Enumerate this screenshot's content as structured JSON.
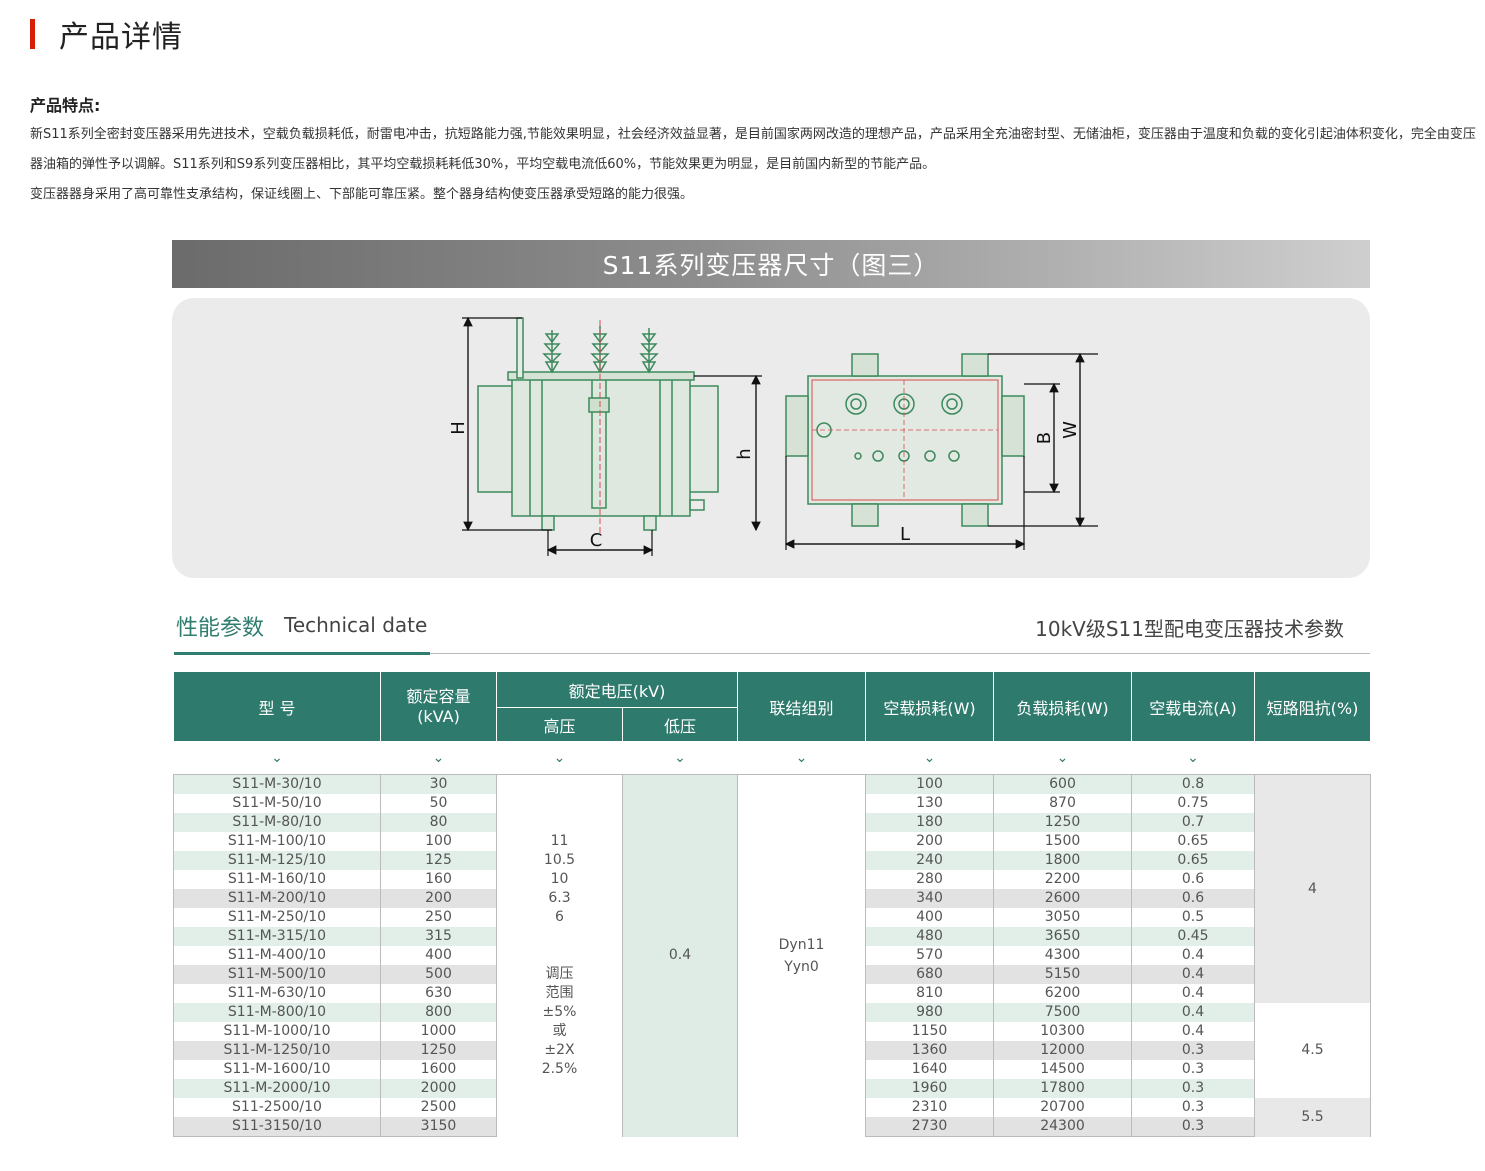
{
  "header": {
    "title": "产品详情"
  },
  "features": {
    "label": "产品特点:",
    "p1": "新S11系列全密封变压器采用先进技术，空载负载损耗低，耐雷电冲击，抗短路能力强,节能效果明显，社会经济效益显著，是目前国家两网改造的理想产品，产品采用全充油密封型、无储油柜，变压器由于温度和负载的变化引起油体积变化，完全由变压器油箱的弹性予以调解。S11系列和S9系列变压器相比，其平均空载损耗耗低30%，平均空载电流低60%，节能效果更为明显，是目前国内新型的节能产品。",
    "p2": "变压器器身采用了高可靠性支承结构，保证线圈上、下部能可靠压紧。整个器身结构使变压器承受短路的能力很强。"
  },
  "figure": {
    "banner": "S11系列变压器尺寸（图三）",
    "labels": {
      "H": "H",
      "h": "h",
      "C": "C",
      "L": "L",
      "B": "B",
      "W": "W"
    }
  },
  "perf": {
    "title_cn": "性能参数",
    "title_en": "Technical date",
    "right_title": "10kV级S11型配电变压器技术参数"
  },
  "table": {
    "headers": {
      "model": "型 号",
      "capacity": "额定容量\n(kVA)",
      "voltage": "额定电压(kV)",
      "hv": "高压",
      "lv": "低压",
      "group": "联结组别",
      "no_load_loss": "空载损耗(W)",
      "load_loss": "负载损耗(W)",
      "no_load_current": "空载电流(A)",
      "impedance": "短路阻抗(%)"
    },
    "arrow": "⌄",
    "hv_text": "11\n10.5\n10\n6.3\n6\n\n\n调压\n范围\n±5%\n或\n±2X\n2.5%",
    "lv_value": "0.4",
    "group_text": "Dyn11\nYyn0",
    "impedance_groups": [
      "4",
      "4.5",
      "5.5"
    ],
    "rows": [
      {
        "model": "S11-M-30/10",
        "cap": "30",
        "p0": "100",
        "pk": "600",
        "i0": "0.8"
      },
      {
        "model": "S11-M-50/10",
        "cap": "50",
        "p0": "130",
        "pk": "870",
        "i0": "0.75"
      },
      {
        "model": "S11-M-80/10",
        "cap": "80",
        "p0": "180",
        "pk": "1250",
        "i0": "0.7"
      },
      {
        "model": "S11-M-100/10",
        "cap": "100",
        "p0": "200",
        "pk": "1500",
        "i0": "0.65"
      },
      {
        "model": "S11-M-125/10",
        "cap": "125",
        "p0": "240",
        "pk": "1800",
        "i0": "0.65"
      },
      {
        "model": "S11-M-160/10",
        "cap": "160",
        "p0": "280",
        "pk": "2200",
        "i0": "0.6"
      },
      {
        "model": "S11-M-200/10",
        "cap": "200",
        "p0": "340",
        "pk": "2600",
        "i0": "0.6"
      },
      {
        "model": "S11-M-250/10",
        "cap": "250",
        "p0": "400",
        "pk": "3050",
        "i0": "0.5"
      },
      {
        "model": "S11-M-315/10",
        "cap": "315",
        "p0": "480",
        "pk": "3650",
        "i0": "0.45"
      },
      {
        "model": "S11-M-400/10",
        "cap": "400",
        "p0": "570",
        "pk": "4300",
        "i0": "0.4"
      },
      {
        "model": "S11-M-500/10",
        "cap": "500",
        "p0": "680",
        "pk": "5150",
        "i0": "0.4"
      },
      {
        "model": "S11-M-630/10",
        "cap": "630",
        "p0": "810",
        "pk": "6200",
        "i0": "0.4"
      },
      {
        "model": "S11-M-800/10",
        "cap": "800",
        "p0": "980",
        "pk": "7500",
        "i0": "0.4"
      },
      {
        "model": "S11-M-1000/10",
        "cap": "1000",
        "p0": "1150",
        "pk": "10300",
        "i0": "0.4"
      },
      {
        "model": "S11-M-1250/10",
        "cap": "1250",
        "p0": "1360",
        "pk": "12000",
        "i0": "0.3"
      },
      {
        "model": "S11-M-1600/10",
        "cap": "1600",
        "p0": "1640",
        "pk": "14500",
        "i0": "0.3"
      },
      {
        "model": "S11-M-2000/10",
        "cap": "2000",
        "p0": "1960",
        "pk": "17800",
        "i0": "0.3"
      },
      {
        "model": "S11-2500/10",
        "cap": "2500",
        "p0": "2310",
        "pk": "20700",
        "i0": "0.3"
      },
      {
        "model": "S11-3150/10",
        "cap": "3150",
        "p0": "2730",
        "pk": "24300",
        "i0": "0.3"
      }
    ]
  }
}
